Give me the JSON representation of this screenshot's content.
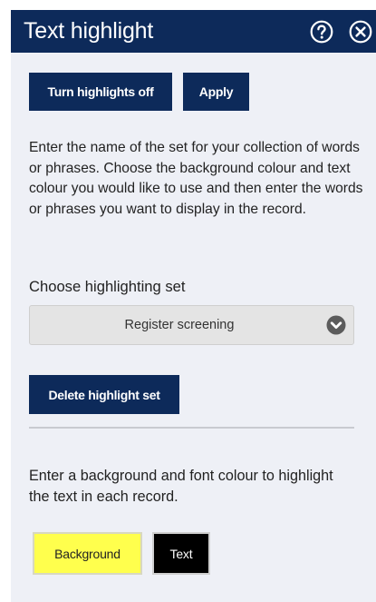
{
  "header": {
    "title": "Text highlight",
    "help_icon": "help-circle-icon",
    "close_icon": "close-circle-icon"
  },
  "actions": {
    "toggle_highlights_label": "Turn highlights off",
    "apply_label": "Apply"
  },
  "description": "Enter the name of the set for your collection of words or phrases. Choose the background colour and text colour you would like to use and then enter the words or phrases you want to display in the record.",
  "highlight_set": {
    "label": "Choose highlighting set",
    "selected": "Register screening",
    "chevron_icon": "chevron-down-circle-icon",
    "delete_label": "Delete highlight set"
  },
  "colours": {
    "instructions": "Enter a background and font colour to highlight the text in each record.",
    "background_label": "Background",
    "background_color": "#ffff4d",
    "text_label": "Text",
    "text_color": "#000000"
  },
  "theme": {
    "brand": "#0d2a5a",
    "panel_bg": "#eef0f6"
  }
}
